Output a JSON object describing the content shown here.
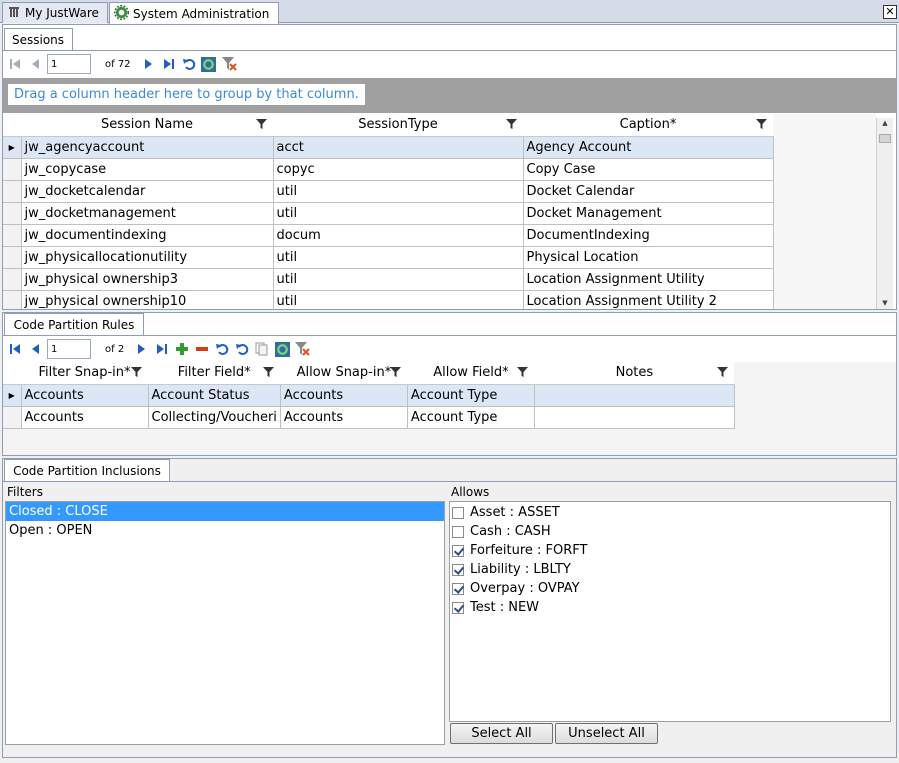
{
  "doc_tabs": [
    {
      "label": "My JustWare"
    },
    {
      "label": "System Administration"
    }
  ],
  "sessions": {
    "tab_label": "Sessions",
    "pager": {
      "page": "1",
      "of": "of 72"
    },
    "group_hint": "Drag a column header here to group by that column.",
    "columns": [
      "Session Name",
      "SessionType",
      "Caption*"
    ],
    "rows": [
      [
        "jw_agencyaccount",
        "acct",
        "Agency Account"
      ],
      [
        "jw_copycase",
        "copyc",
        "Copy Case"
      ],
      [
        "jw_docketcalendar",
        "util",
        "Docket Calendar"
      ],
      [
        "jw_docketmanagement",
        "util",
        "Docket Management"
      ],
      [
        "jw_documentindexing",
        "docum",
        "DocumentIndexing"
      ],
      [
        "jw_physicallocationutility",
        "util",
        "Physical Location"
      ],
      [
        "jw_physical ownership3",
        "util",
        "Location Assignment Utility"
      ],
      [
        "jw_physical ownership10",
        "util",
        "Location Assignment Utility 2"
      ]
    ]
  },
  "rules": {
    "tab_label": "Code Partition Rules",
    "pager": {
      "page": "1",
      "of": "of 2"
    },
    "columns": [
      "Filter Snap-in*",
      "Filter Field*",
      "Allow Snap-in*",
      "Allow Field*",
      "Notes"
    ],
    "rows": [
      [
        "Accounts",
        "Account Status",
        "Accounts",
        "Account Type",
        ""
      ],
      [
        "Accounts",
        "Collecting/Voucheri",
        "Accounts",
        "Account Type",
        ""
      ]
    ]
  },
  "inclusions": {
    "tab_label": "Code Partition Inclusions",
    "filters_label": "Filters",
    "allows_label": "Allows",
    "filters": [
      {
        "label": "Closed : CLOSE",
        "selected": true
      },
      {
        "label": "Open : OPEN",
        "selected": false
      }
    ],
    "allows": [
      {
        "label": "Asset : ASSET",
        "checked": false
      },
      {
        "label": "Cash : CASH",
        "checked": false
      },
      {
        "label": "Forfeiture : FORFT",
        "checked": true
      },
      {
        "label": "Liability : LBLTY",
        "checked": true
      },
      {
        "label": "Overpay : OVPAY",
        "checked": true
      },
      {
        "label": "Test : NEW",
        "checked": true
      }
    ],
    "select_all": "Select All",
    "unselect_all": "Unselect All"
  },
  "colors": {
    "accent_blue": "#3399ff",
    "selected_row": "#dbe7f5",
    "group_hint_text": "#3a8ad8",
    "nav_icon": "#1f5fbf",
    "filter_clear_icon": "#d9541e",
    "add_icon": "#2e9d2e",
    "remove_icon": "#d04010"
  }
}
